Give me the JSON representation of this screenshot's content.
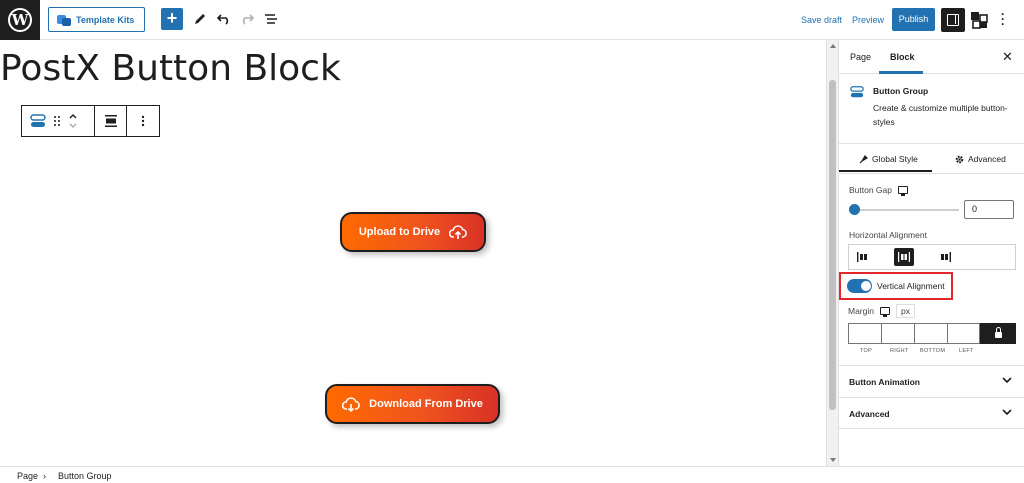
{
  "toolbar": {
    "logo_glyph": "W",
    "template_kits_label": "Template Kits",
    "add_label": "+",
    "save_draft_label": "Save draft",
    "preview_label": "Preview",
    "publish_label": "Publish"
  },
  "editor": {
    "post_title": "PostX Button Block",
    "buttons": [
      {
        "label": "Upload to Drive"
      },
      {
        "label": "Download From Drive"
      }
    ]
  },
  "sidebar": {
    "tabs": [
      {
        "label": "Page"
      },
      {
        "label": "Block"
      }
    ],
    "block": {
      "name": "Button Group",
      "description": "Create & customize multiple button-styles"
    },
    "sub_tabs": [
      {
        "label": "Global Style"
      },
      {
        "label": "Advanced"
      }
    ],
    "button_gap": {
      "label": "Button Gap",
      "value": "0"
    },
    "horizontal_alignment": {
      "label": "Horizontal Alignment",
      "selected": "center"
    },
    "vertical_alignment": {
      "label": "Vertical Alignment",
      "enabled": true
    },
    "margin": {
      "label": "Margin",
      "unit": "px",
      "sides": [
        "TOP",
        "RIGHT",
        "BOTTOM",
        "LEFT"
      ]
    },
    "panels": [
      {
        "label": "Button Animation"
      },
      {
        "label": "Advanced"
      }
    ]
  },
  "breadcrumb": {
    "items": [
      "Page",
      "Button Group"
    ],
    "separator": "›"
  },
  "colors": {
    "accent": "#2271b1",
    "button_gradient_start": "#ff6a00",
    "button_gradient_end": "#d93126",
    "highlight": "#e2262a"
  }
}
